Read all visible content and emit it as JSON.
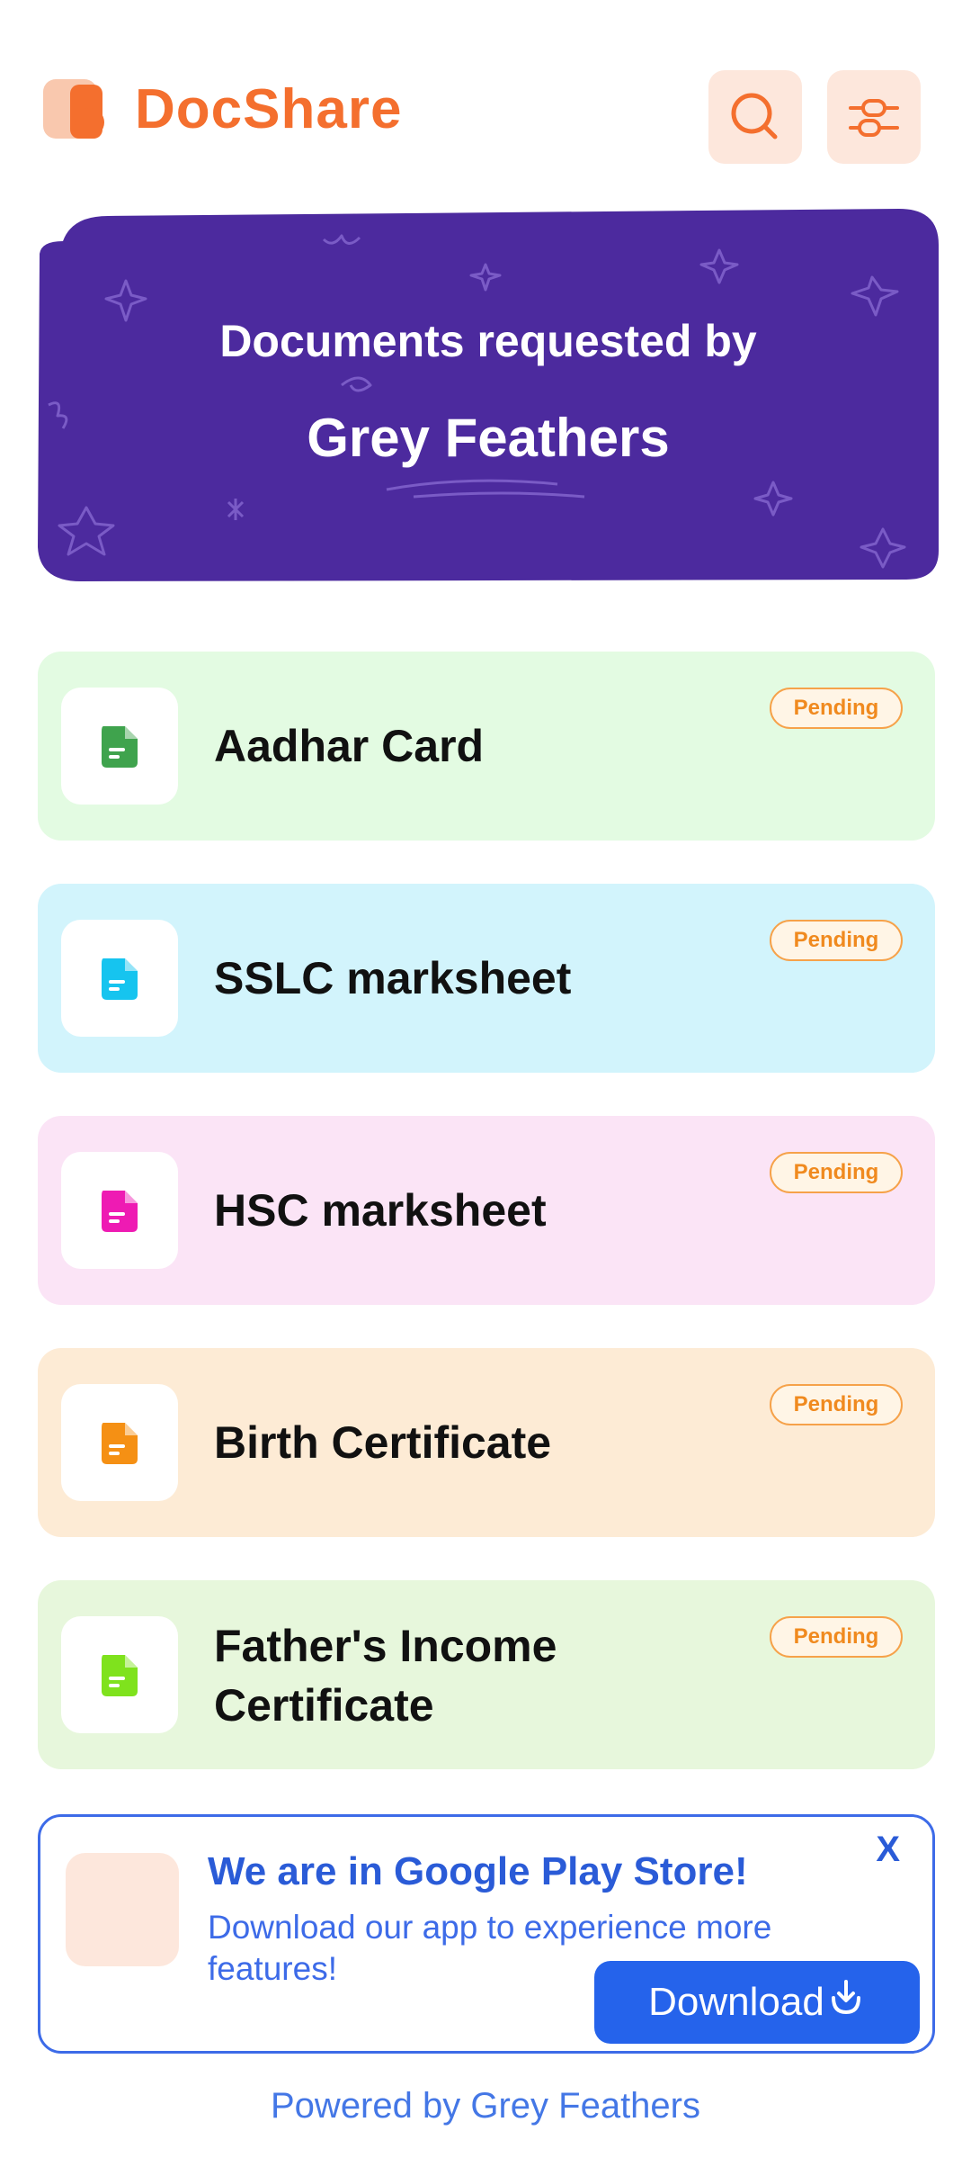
{
  "app": {
    "name": "DocShare",
    "brand_color": "#F46F2E"
  },
  "header": {
    "search_icon": "search-icon",
    "filter_icon": "sliders-icon"
  },
  "banner": {
    "line1": "Documents requested by",
    "line2": "Grey Feathers",
    "background": "#4C2A9E"
  },
  "documents": [
    {
      "title": "Aadhar Card",
      "status": "Pending",
      "bg": "#E3FBE2",
      "icon_color": "#3FA34D"
    },
    {
      "title": "SSLC marksheet",
      "status": "Pending",
      "bg": "#D2F4FC",
      "icon_color": "#16C4EF"
    },
    {
      "title": "HSC marksheet",
      "status": "Pending",
      "bg": "#FBE4F6",
      "icon_color": "#EE1BB3"
    },
    {
      "title": "Birth Certificate",
      "status": "Pending",
      "bg": "#FDEBD5",
      "icon_color": "#F59014"
    },
    {
      "title": "Father's Income Certificate",
      "status": "Pending",
      "bg": "#E7F7DC",
      "icon_color": "#7FE21D"
    }
  ],
  "promo": {
    "title": "We are in Google Play Store!",
    "description": "Download our app to experience more features!",
    "close": "X",
    "download_label": "Download"
  },
  "footer": {
    "text": "Powered by Grey Feathers"
  }
}
